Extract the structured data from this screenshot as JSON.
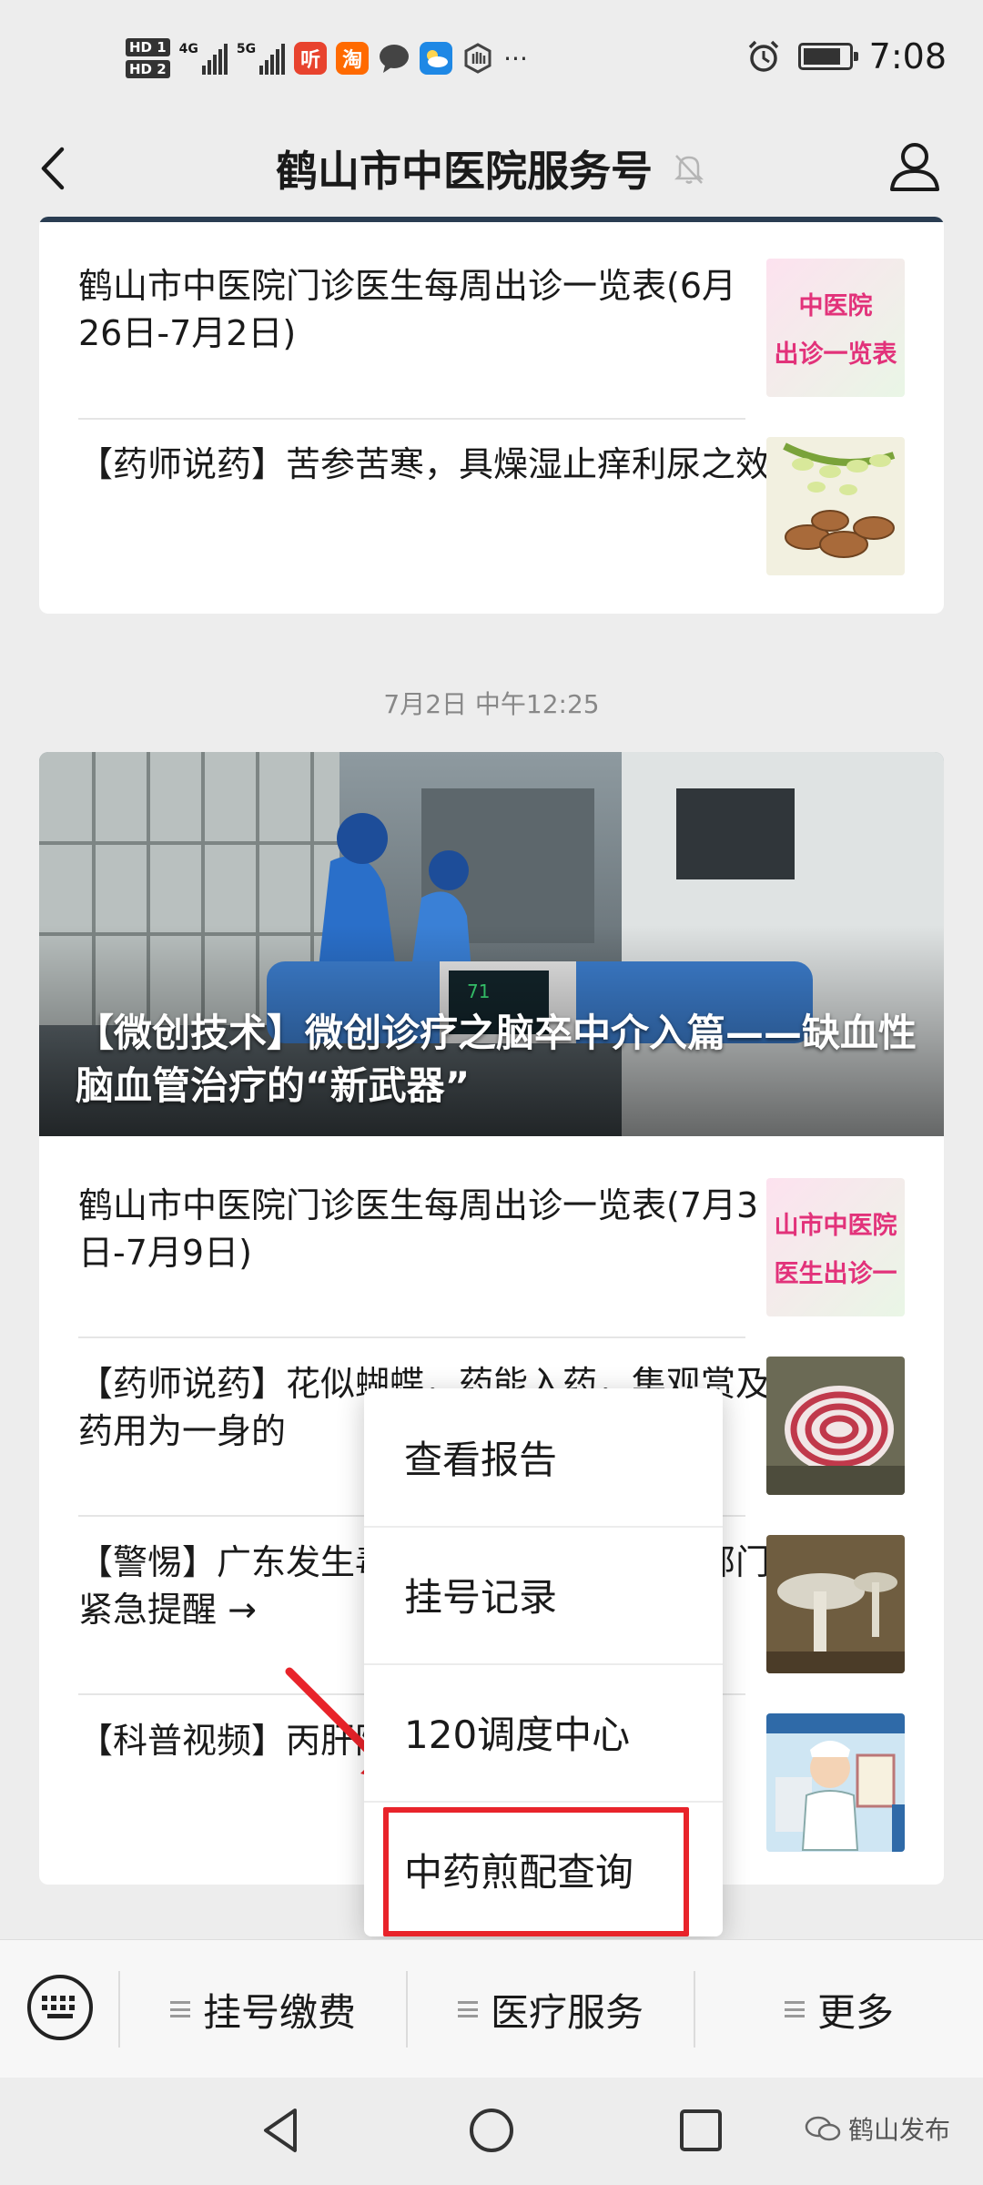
{
  "status": {
    "time": "7:08",
    "hd1": "HD 1",
    "hd2": "HD 2",
    "net1": "4G",
    "net2": "5G",
    "app1": "听",
    "app2": "淘",
    "more": "···"
  },
  "header": {
    "title": "鹤山市中医院服务号"
  },
  "card1": {
    "items": [
      {
        "text": "鹤山市中医院门诊医生每周出诊一览表(6月26日-7月2日)",
        "thumb_line1": "中医院",
        "thumb_line2": "出诊一览表"
      },
      {
        "text": "【药师说药】苦参苦寒，具燥湿止痒利尿之效"
      }
    ]
  },
  "timestamp": "7月2日 中午12:25",
  "card2": {
    "hero_title": "【微创技术】微创诊疗之脑卒中介入篇——缺血性脑血管治疗的“新武器”",
    "monitor_value": "71",
    "items": [
      {
        "text": "鹤山市中医院门诊医生每周出诊一览表(7月3日-7月9日)",
        "thumb_line1": "山市中医院",
        "thumb_line2": "医生出诊一"
      },
      {
        "text": "【药师说药】花似蝴蝶，药能入药，集观赏及药用为一身的"
      },
      {
        "text": "【警惕】广东发生毒蘑菇中毒事件！相关部门紧急提醒 →"
      },
      {
        "text": "【科普视频】丙肝防治之大众人群"
      }
    ]
  },
  "popup": {
    "items": [
      "查看报告",
      "挂号记录",
      "120调度中心",
      "中药煎配查询"
    ]
  },
  "menubar": {
    "items": [
      "挂号缴费",
      "医疗服务",
      "更多"
    ]
  },
  "watermark": "鹤山发布",
  "colors": {
    "highlight": "#e8232a",
    "background": "#ededed"
  }
}
